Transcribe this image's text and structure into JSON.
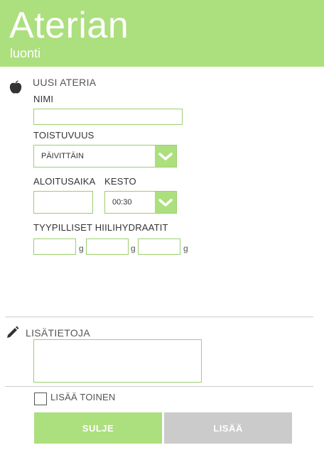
{
  "header": {
    "title": "Aterian",
    "subtitle": "luonti"
  },
  "meal_section": {
    "title": "UUSI ATERIA",
    "icon": "apple-icon",
    "name_label": "NIMI",
    "name_value": "",
    "repeat_label": "TOISTUVUUS",
    "repeat_value": "PÄIVITTÄIN",
    "start_label": "ALOITUSAIKA",
    "start_value": "",
    "duration_label": "KESTO",
    "duration_value": "00:30",
    "carbs_label": "TYYPILLISET HIILIHYDRAATIT",
    "carbs_unit": "g",
    "carbs_values": [
      "",
      "",
      ""
    ]
  },
  "notes_section": {
    "title": "LISÄTIETOJA",
    "icon": "pencil-icon",
    "notes_value": ""
  },
  "add_another": {
    "label": "LISÄÄ TOINEN",
    "checked": false
  },
  "buttons": {
    "close_label": "SULJE",
    "add_label": "LISÄÄ"
  },
  "colors": {
    "accent": "#acdf7e",
    "disabled": "#cbcbcb"
  }
}
